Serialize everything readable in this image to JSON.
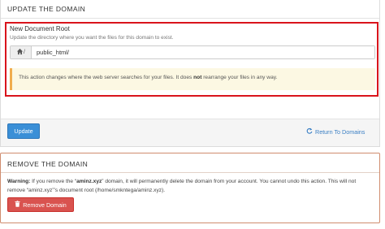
{
  "update_panel": {
    "title": "UPDATE THE DOMAIN",
    "field_label": "New Document Root",
    "field_help": "Update the directory where you want the files for this domain to exist.",
    "input_prefix": "/",
    "input_value": "public_html/",
    "alert_before": "This action changes where the web server searches for your files. It does ",
    "alert_bold": "not",
    "alert_after": " rearrange your files in any way.",
    "update_button": "Update",
    "return_link": "Return To Domains"
  },
  "remove_panel": {
    "title": "REMOVE THE DOMAIN",
    "warning_label": "Warning:",
    "warning_part1": " If you remove the “",
    "domain": "aminz.xyz",
    "warning_part2": "” domain, it will permanently delete the domain from your account. You cannot undo this action. This will not remove “",
    "warning_part3": "”’s document root (/home/smkntega/aminz.xyz).",
    "remove_button": "Remove Domain"
  },
  "colors": {
    "highlight_border": "#d9141c",
    "primary": "#3a8fd7",
    "danger": "#d9534f",
    "alert_bg": "#fcf8e3",
    "link": "#3a7fc4"
  },
  "icons": {
    "input_prefix": "home-icon",
    "return_link": "refresh-icon",
    "remove_button": "trash-icon"
  }
}
